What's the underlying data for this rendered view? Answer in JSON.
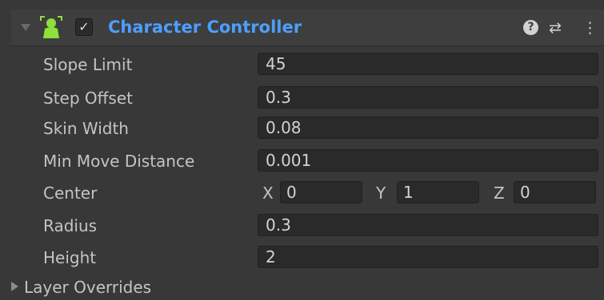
{
  "header": {
    "title": "Character Controller",
    "enabled": true,
    "checkbox_glyph": "✓",
    "help_glyph": "?",
    "presets_glyph": "⇄",
    "menu_glyph": "⋮",
    "icon_color": "#8ee03a",
    "title_color": "#4c9fff"
  },
  "fields": [
    {
      "label": "Slope Limit",
      "value": "45"
    },
    {
      "label": "Step Offset",
      "value": "0.3"
    },
    {
      "label": "Skin Width",
      "value": "0.08"
    },
    {
      "label": "Min Move Distance",
      "value": "0.001"
    },
    {
      "label": "Center",
      "x_label": "X",
      "x": "0",
      "y_label": "Y",
      "y": "1",
      "z_label": "Z",
      "z": "0"
    },
    {
      "label": "Radius",
      "value": "0.3"
    },
    {
      "label": "Height",
      "value": "2"
    }
  ],
  "layer_overrides": {
    "label": "Layer Overrides"
  }
}
